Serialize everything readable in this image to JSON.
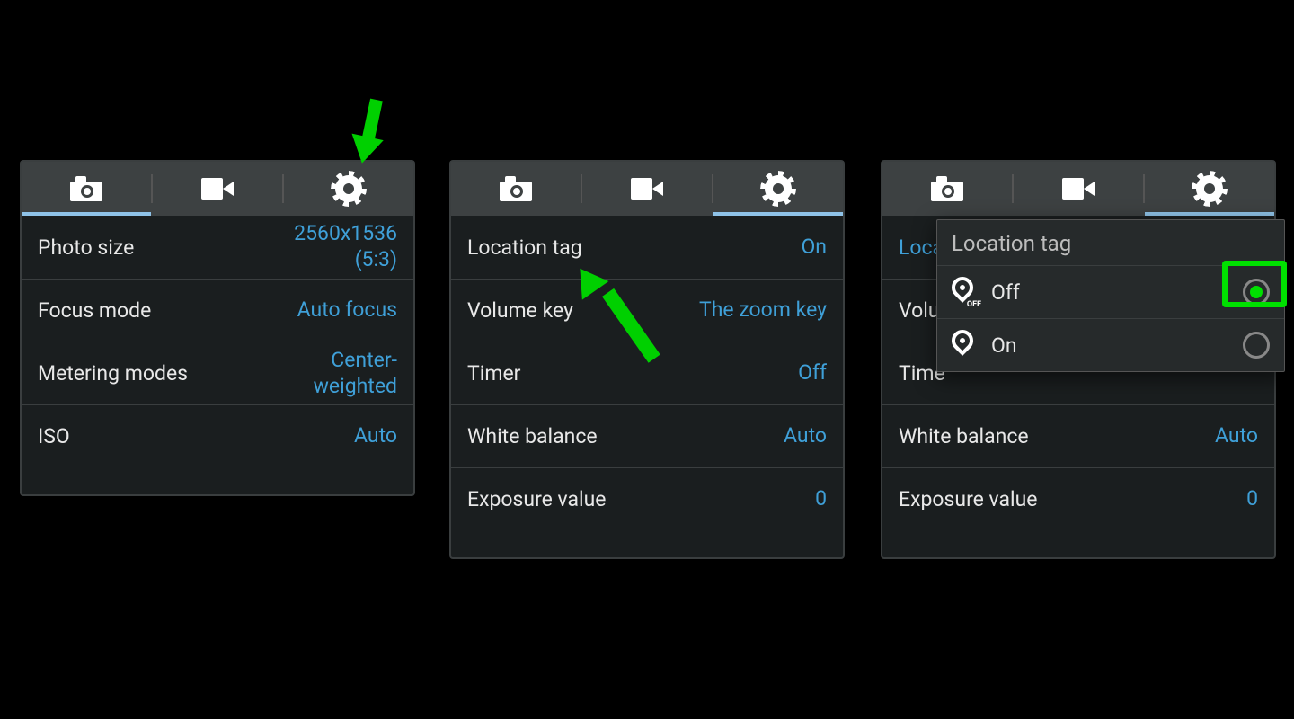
{
  "colors": {
    "accent": "#3fa0d8",
    "highlight": "#00e000"
  },
  "panels": [
    {
      "active_tab": "camera",
      "rows": [
        {
          "label": "Photo size",
          "value": "2560x1536\n(5:3)"
        },
        {
          "label": "Focus mode",
          "value": "Auto focus"
        },
        {
          "label": "Metering modes",
          "value": "Center-\nweighted"
        },
        {
          "label": "ISO",
          "value": "Auto"
        }
      ]
    },
    {
      "active_tab": "gear",
      "rows": [
        {
          "label": "Location tag",
          "value": "On"
        },
        {
          "label": "Volume key",
          "value": "The zoom key"
        },
        {
          "label": "Timer",
          "value": "Off"
        },
        {
          "label": "White balance",
          "value": "Auto"
        },
        {
          "label": "Exposure value",
          "value": "0"
        }
      ]
    },
    {
      "active_tab": "gear",
      "rows": [
        {
          "label": "Loca",
          "value": ""
        },
        {
          "label": "Volu",
          "value": ""
        },
        {
          "label": "Time",
          "value": ""
        },
        {
          "label": "White balance",
          "value": "Auto"
        },
        {
          "label": "Exposure value",
          "value": "0"
        }
      ],
      "popup": {
        "title": "Location tag",
        "options": [
          {
            "label": "Off",
            "selected": true
          },
          {
            "label": "On",
            "selected": false
          }
        ]
      }
    }
  ]
}
